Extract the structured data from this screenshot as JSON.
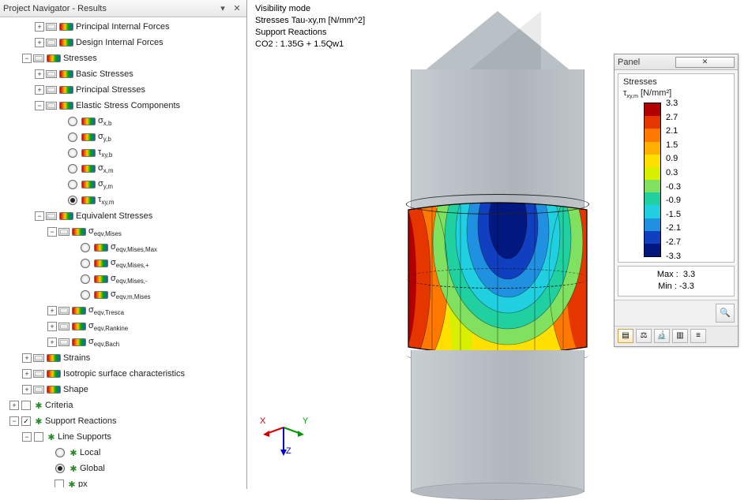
{
  "navigator": {
    "title": "Project Navigator - Results",
    "items": {
      "principal_internal_forces": "Principal Internal Forces",
      "design_internal_forces": "Design Internal Forces",
      "stresses": "Stresses",
      "basic_stresses": "Basic Stresses",
      "principal_stresses": "Principal Stresses",
      "elastic_stress_components": "Elastic Stress Components",
      "sigma_xb": "σ",
      "sigma_xb_sub": "x,b",
      "sigma_yb": "σ",
      "sigma_yb_sub": "y,b",
      "tau_xyb": "τ",
      "tau_xyb_sub": "xy,b",
      "sigma_xm": "σ",
      "sigma_xm_sub": "x,m",
      "sigma_ym": "σ",
      "sigma_ym_sub": "y,m",
      "tau_xym": "τ",
      "tau_xym_sub": "xy,m",
      "equivalent_stresses": "Equivalent Stresses",
      "eqv_mises": "σ",
      "eqv_mises_sub": "eqv,Mises",
      "eqv_mises_max": "σ",
      "eqv_mises_max_sub": "eqv,Mises,Max",
      "eqv_mises_plus": "σ",
      "eqv_mises_plus_sub": "eqv,Mises,+",
      "eqv_mises_minus": "σ",
      "eqv_mises_minus_sub": "eqv,Mises,-",
      "eqv_m_mises": "σ",
      "eqv_m_mises_sub": "eqv,m,Mises",
      "eqv_tresca": "σ",
      "eqv_tresca_sub": "eqv,Tresca",
      "eqv_rankine": "σ",
      "eqv_rankine_sub": "eqv,Rankine",
      "eqv_bach": "σ",
      "eqv_bach_sub": "eqv,Bach",
      "strains": "Strains",
      "isotropic": "Isotropic surface characteristics",
      "shape": "Shape",
      "criteria": "Criteria",
      "support_reactions": "Support Reactions",
      "line_supports": "Line Supports",
      "local": "Local",
      "global": "Global",
      "px": "px"
    }
  },
  "overlay": {
    "l1": "Visibility mode",
    "l2": "Stresses Tau-xy,m [N/mm^2]",
    "l3": "Support Reactions",
    "l4": "CO2 : 1.35G + 1.5Qw1"
  },
  "axes": {
    "x": "X",
    "y": "Y",
    "z": "Z"
  },
  "panel": {
    "title": "Panel",
    "legend_title": "Stresses",
    "legend_sub_sym": "τ",
    "legend_sub_idx": "xy,m",
    "legend_sub_unit": " [N/mm²]",
    "colors": [
      "#b20000",
      "#e63600",
      "#ff7800",
      "#ffb000",
      "#ffe000",
      "#d8f000",
      "#80e060",
      "#20d0a0",
      "#20d0e0",
      "#2090e0",
      "#1040c0",
      "#001880"
    ],
    "values": [
      "3.3",
      "2.7",
      "2.1",
      "1.5",
      "0.9",
      "0.3",
      "-0.3",
      "-0.9",
      "-1.5",
      "-2.1",
      "-2.7",
      "-3.3"
    ],
    "max_label": "Max :",
    "max_val": " 3.3",
    "min_label": "Min :",
    "min_val": "-3.3"
  },
  "chart_data": {
    "type": "heatmap",
    "title": "Stresses Tau-xy,m [N/mm^2]",
    "colorbar": {
      "label": "τxy,m [N/mm²]",
      "ticks": [
        3.3,
        2.7,
        2.1,
        1.5,
        0.9,
        0.3,
        -0.3,
        -0.9,
        -1.5,
        -2.1,
        -2.7,
        -3.3
      ],
      "colors": [
        "#b20000",
        "#e63600",
        "#ff7800",
        "#ffb000",
        "#ffe000",
        "#d8f000",
        "#80e060",
        "#20d0a0",
        "#20d0e0",
        "#2090e0",
        "#1040c0",
        "#001880"
      ]
    },
    "range": {
      "min": -3.3,
      "max": 3.3
    },
    "load_case": "CO2 : 1.35G + 1.5Qw1"
  }
}
